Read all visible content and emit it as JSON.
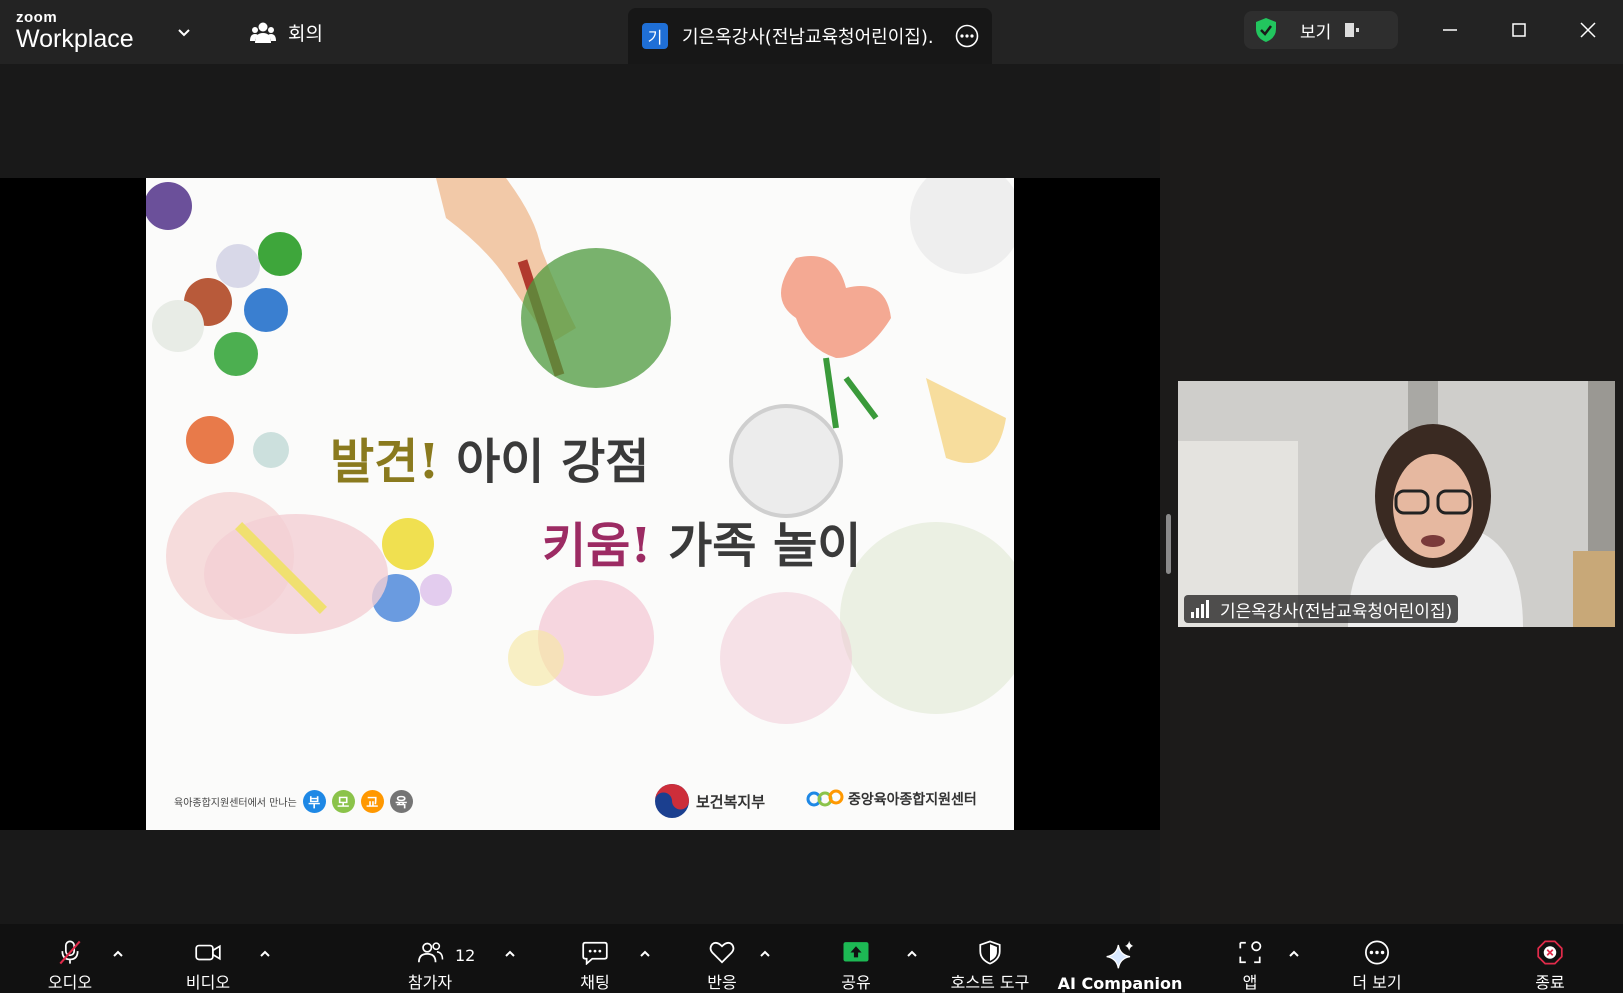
{
  "app": {
    "logo_top": "zoom",
    "logo_bottom": "Workplace",
    "meeting_label": "회의"
  },
  "tab": {
    "avatar_letter": "기",
    "title": "기은옥강사(전남교육청어린이집)."
  },
  "view_pill": {
    "label": "보기",
    "security_color": "#22c55e"
  },
  "slide": {
    "title_line1_accent": "발견!",
    "title_line1_rest": " 아이 강점",
    "title_line2_accent": "키움!",
    "title_line2_rest": " 가족 놀이",
    "footer_left_text": "육아종합지원센터에서 만나는",
    "footer_bubbles": [
      "부",
      "모",
      "교",
      "육"
    ],
    "bubble_colors": [
      "#1e88e5",
      "#8bc34a",
      "#ff9800",
      "#757575"
    ],
    "org1": "보건복지부",
    "org2": "중앙육아종합지원센터"
  },
  "participant": {
    "name": "기은옥강사(전남교육청어린이집)"
  },
  "toolbar": {
    "audio": "오디오",
    "video": "비디오",
    "participants": "참가자",
    "participants_count": "12",
    "chat": "채팅",
    "react": "반응",
    "share": "공유",
    "host_tools": "호스트 도구",
    "ai_companion": "AI Companion",
    "apps": "앱",
    "more": "더 보기",
    "end": "종료",
    "share_color": "#1db954",
    "end_color": "#e02b4a"
  }
}
